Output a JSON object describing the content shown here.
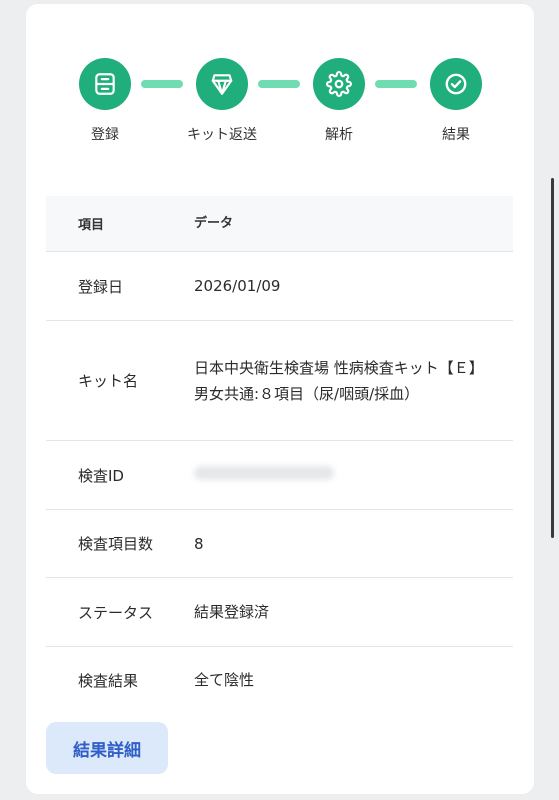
{
  "stepper": {
    "steps": [
      {
        "label": "登録",
        "icon": "register-icon"
      },
      {
        "label": "キット返送",
        "icon": "return-kit-icon"
      },
      {
        "label": "解析",
        "icon": "gear-icon"
      },
      {
        "label": "結果",
        "icon": "check-circle-icon"
      }
    ]
  },
  "table": {
    "header": {
      "item": "項目",
      "data": "データ"
    },
    "rows": [
      {
        "label": "登録日",
        "value": "2026/01/09"
      },
      {
        "label": "キット名",
        "value": "日本中央衛生検査場 性病検査キット【Ｅ】男女共通:８項目（尿/咽頭/採血）"
      },
      {
        "label": "検査ID",
        "value": ""
      },
      {
        "label": "検査項目数",
        "value": "8"
      },
      {
        "label": "ステータス",
        "value": "結果登録済"
      },
      {
        "label": "検査結果",
        "value": "全て陰性"
      }
    ]
  },
  "detail_button": {
    "label": "結果詳細"
  },
  "colors": {
    "step": "#1fae7c",
    "connector": "#6fdcb2",
    "button_bg": "#dce9fb",
    "button_text": "#2f5ec7"
  }
}
